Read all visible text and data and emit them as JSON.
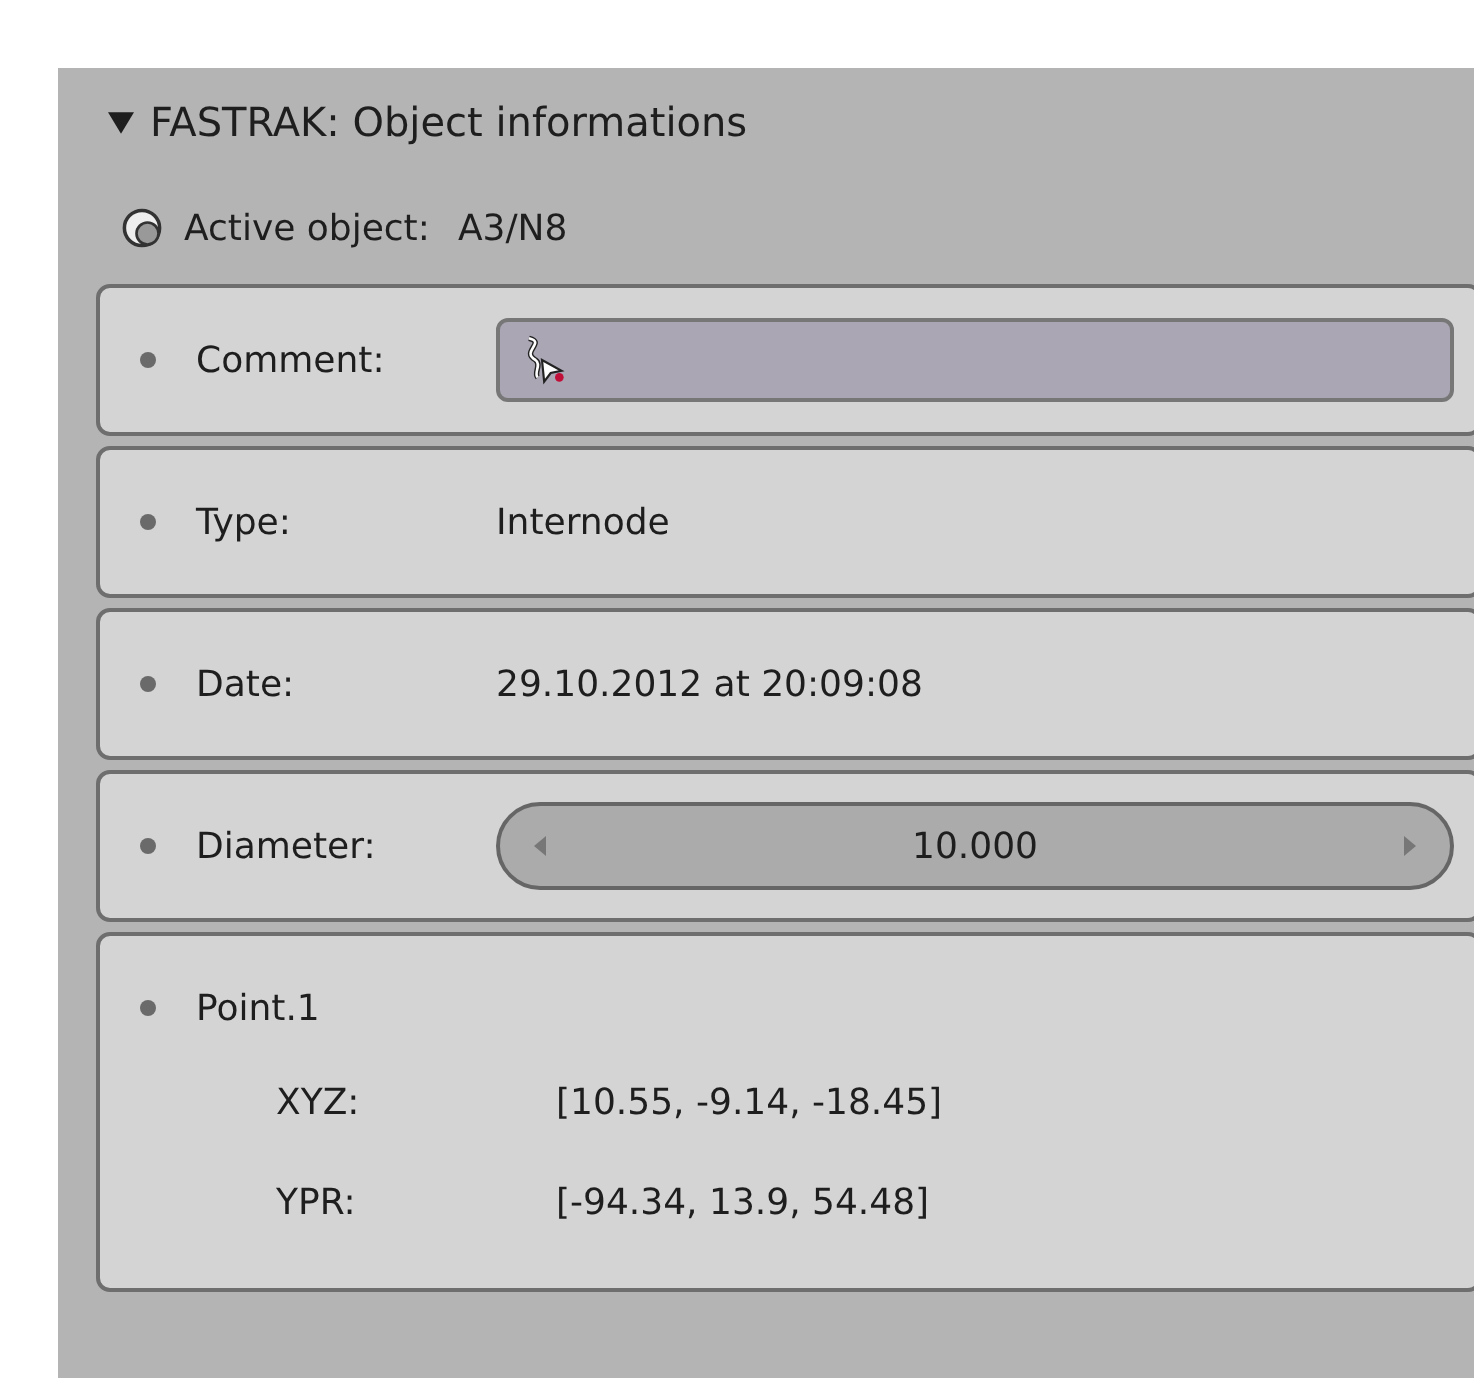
{
  "panel": {
    "title": "FASTRAK: Object informations",
    "expanded": true
  },
  "active_object": {
    "label": "Active object:",
    "value": "A3/N8"
  },
  "rows": [
    {
      "kind": "text-field",
      "label": "Comment:"
    },
    {
      "kind": "value",
      "label": "Type:",
      "value": "Internode"
    },
    {
      "kind": "value",
      "label": "Date:",
      "value": "29.10.2012 at 20:09:08"
    },
    {
      "kind": "number-field",
      "label": "Diameter:",
      "value": "10.000"
    },
    {
      "kind": "point",
      "label": "Point.1",
      "fields": [
        {
          "label": "XYZ:",
          "value": "[10.55, -9.14, -18.45]"
        },
        {
          "label": "YPR:",
          "value": "[-94.34, 13.9, 54.48]"
        }
      ]
    }
  ]
}
